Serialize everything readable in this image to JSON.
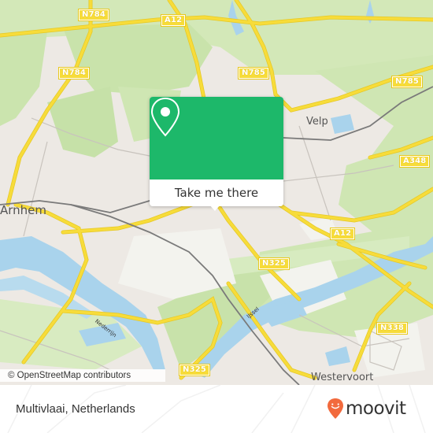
{
  "map": {
    "colors": {
      "land": "#ede9e4",
      "green": "#cfe7b2",
      "park": "#dcedc6",
      "water": "#a9d3ec",
      "road": "#f7dc3a",
      "rail": "#7a7a7a",
      "accent": "#1db86a",
      "moovit": "#f26a3d"
    },
    "road_labels": [
      {
        "id": "n784-top",
        "text": "N784"
      },
      {
        "id": "a12-top",
        "text": "A12"
      },
      {
        "id": "n784-left",
        "text": "N784"
      },
      {
        "id": "n785-mid",
        "text": "N785"
      },
      {
        "id": "n785-right",
        "text": "N785"
      },
      {
        "id": "a348",
        "text": "A348"
      },
      {
        "id": "a12-mid",
        "text": "A12"
      },
      {
        "id": "n325-mid",
        "text": "N325"
      },
      {
        "id": "n338",
        "text": "N338"
      },
      {
        "id": "n325-bottom",
        "text": "N325"
      }
    ],
    "places": [
      {
        "id": "arnhem",
        "text": "Arnhem"
      },
      {
        "id": "velp",
        "text": "Velp"
      },
      {
        "id": "westervoort",
        "text": "Westervoort"
      }
    ],
    "rivers": [
      {
        "id": "nederrijn",
        "text": "Nederrijn"
      },
      {
        "id": "ijssel",
        "text": "IJssel"
      }
    ],
    "attribution": "© OpenStreetMap contributors"
  },
  "popup": {
    "icon": "map-pin-icon",
    "button_label": "Take me there"
  },
  "footer": {
    "title": "Multivlaai, Netherlands",
    "logo_text": "moovit",
    "logo_icon": "moovit-smile-pin-icon"
  }
}
